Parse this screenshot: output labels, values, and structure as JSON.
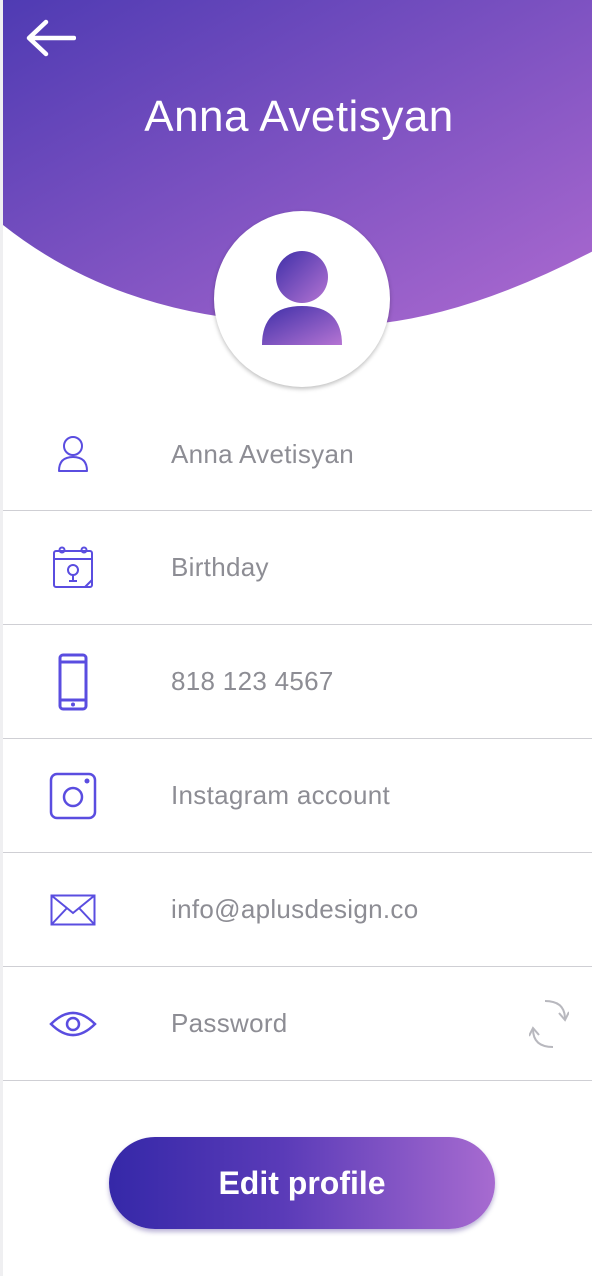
{
  "header": {
    "back_icon": "arrow-left-icon",
    "name": "Anna Avetisyan",
    "gradient_start": "#4f3bb3",
    "gradient_end": "#a868cf"
  },
  "avatar": {
    "icon": "user-silhouette-icon"
  },
  "fields": [
    {
      "icon": "user-icon",
      "text": "Anna Avetisyan"
    },
    {
      "icon": "calendar-icon",
      "text": "Birthday"
    },
    {
      "icon": "smartphone-icon",
      "text": "818 123 4567"
    },
    {
      "icon": "instagram-icon",
      "text": "Instagram account"
    },
    {
      "icon": "envelope-icon",
      "text": "info@aplusdesign.co"
    },
    {
      "icon": "eye-icon",
      "text": "Password",
      "action_icon": "refresh-icon"
    }
  ],
  "edit_button": {
    "label": "Edit profile"
  },
  "colors": {
    "accent": "#5a4de0",
    "text_muted": "#8d8d94",
    "divider": "#cfcfd4"
  }
}
